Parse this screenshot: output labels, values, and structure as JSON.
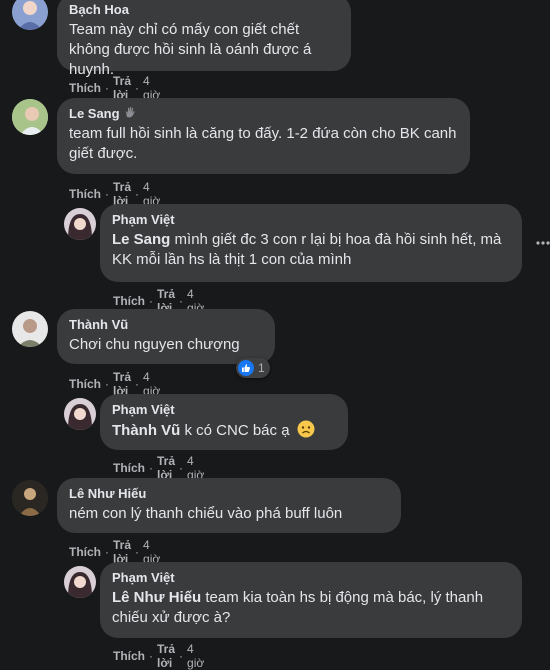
{
  "actions": {
    "like": "Thích",
    "reply": "Trả lời",
    "sep": "·"
  },
  "comments": [
    {
      "author": "Bạch Hoa",
      "text": "Team này chỉ có mấy con giết chết không được hồi sinh là oánh được á huynh.",
      "time": "4 giờ"
    },
    {
      "author": "Le Sang",
      "text": "team full hồi sinh là căng to đấy. 1-2 đứa còn cho BK canh giết được.",
      "time": "4 giờ"
    },
    {
      "author": "Phạm Việt",
      "mention": "Le Sang",
      "text": " mình giết đc 3 con r lại bị hoa đà hồi sinh hết, mà KK mỗi lần hs là thịt 1 con của mình",
      "time": "4 giờ"
    },
    {
      "author": "Thành Vũ",
      "text": "Chơi chu nguyen chượng",
      "time": "4 giờ",
      "reaction_count": "1"
    },
    {
      "author": "Phạm Việt",
      "mention": "Thành Vũ",
      "text": " k có CNC bác ạ",
      "time": "4 giờ"
    },
    {
      "author": "Lê Như Hiếu",
      "text": "ném con lý thanh chiểu vào phá buff luôn",
      "time": "4 giờ"
    },
    {
      "author": "Phạm Việt",
      "mention": "Lê Như Hiếu",
      "text": " team kia toàn hs bị động mà bác, lý thanh chiếu xử được à?",
      "time": "4 giờ"
    }
  ]
}
